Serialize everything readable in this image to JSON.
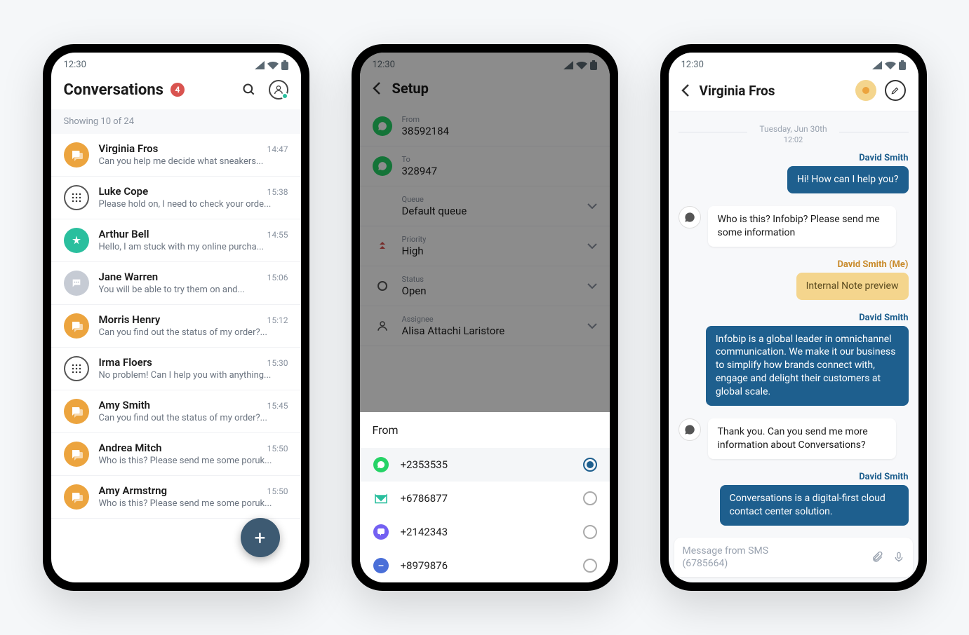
{
  "status": {
    "time": "12:30"
  },
  "screen1": {
    "title": "Conversations",
    "badge": "4",
    "showing": "Showing 10 of 24",
    "items": [
      {
        "name": "Virginia Fros",
        "time": "14:47",
        "preview": "Can you help me decide what sneakers...",
        "icon": "orange"
      },
      {
        "name": "Luke Cope",
        "time": "15:38",
        "preview": "Please hold on, I need to check your orde...",
        "icon": "white"
      },
      {
        "name": "Arthur Bell",
        "time": "14:55",
        "preview": "Hello, I am stuck with my online purcha...",
        "icon": "teal"
      },
      {
        "name": "Jane Warren",
        "time": "15:06",
        "preview": "You will be able to try them on and...",
        "icon": "gray"
      },
      {
        "name": "Morris Henry",
        "time": "15:12",
        "preview": "Can you find out the status of my order?...",
        "icon": "orange"
      },
      {
        "name": "Irma Floers",
        "time": "15:30",
        "preview": "No problem! Can I help you with anything...",
        "icon": "white"
      },
      {
        "name": "Amy Smith",
        "time": "15:45",
        "preview": "Can you find out the status of my order?...",
        "icon": "orange"
      },
      {
        "name": "Andrea Mitch",
        "time": "15:50",
        "preview": "Who is this? Please send me some  poruk...",
        "icon": "orange"
      },
      {
        "name": "Amy Armstrng",
        "time": "15:50",
        "preview": "Who is this? Please send me some  poruk...",
        "icon": "orange"
      }
    ]
  },
  "screen2": {
    "title": "Setup",
    "rows": {
      "from": {
        "label": "From",
        "value": "38592184"
      },
      "to": {
        "label": "To",
        "value": "328947"
      },
      "queue": {
        "label": "Queue",
        "value": "Default queue"
      },
      "priority": {
        "label": "Priority",
        "value": "High"
      },
      "status": {
        "label": "Status",
        "value": "Open"
      },
      "assignee": {
        "label": "Assignee",
        "value": "Alisa Attachi Laristore"
      }
    },
    "sheet": {
      "title": "From",
      "options": [
        {
          "label": "+2353535",
          "type": "whatsapp",
          "selected": true
        },
        {
          "label": "+6786877",
          "type": "email",
          "selected": false
        },
        {
          "label": "+2142343",
          "type": "viber",
          "selected": false
        },
        {
          "label": "+8979876",
          "type": "chat",
          "selected": false
        }
      ]
    }
  },
  "screen3": {
    "name": "Virginia Fros",
    "date": "Tuesday, Jun 30th",
    "dateTime": "12:02",
    "messages": {
      "m1_sender": "David Smith",
      "m1_text": "Hi! How can I help you?",
      "m2_text": "Who is this? Infobip? Please send me some information",
      "m3_sender": "David Smith (Me)",
      "m3_text": "Internal Note preview",
      "m4_sender": "David Smith",
      "m4_text": "Infobip is a global leader in omnichannel communication. We make  it our business  to simplify how brands connect with, engage and delight their customers at global scale.",
      "m5_text": "Thank you. Can you send me more information about Conversations?",
      "m6_sender": "David Smith",
      "m6_text": "Conversations is a digital-first cloud contact center solution."
    },
    "composer": {
      "line1": "Message from SMS",
      "line2": "(6785664)"
    }
  }
}
